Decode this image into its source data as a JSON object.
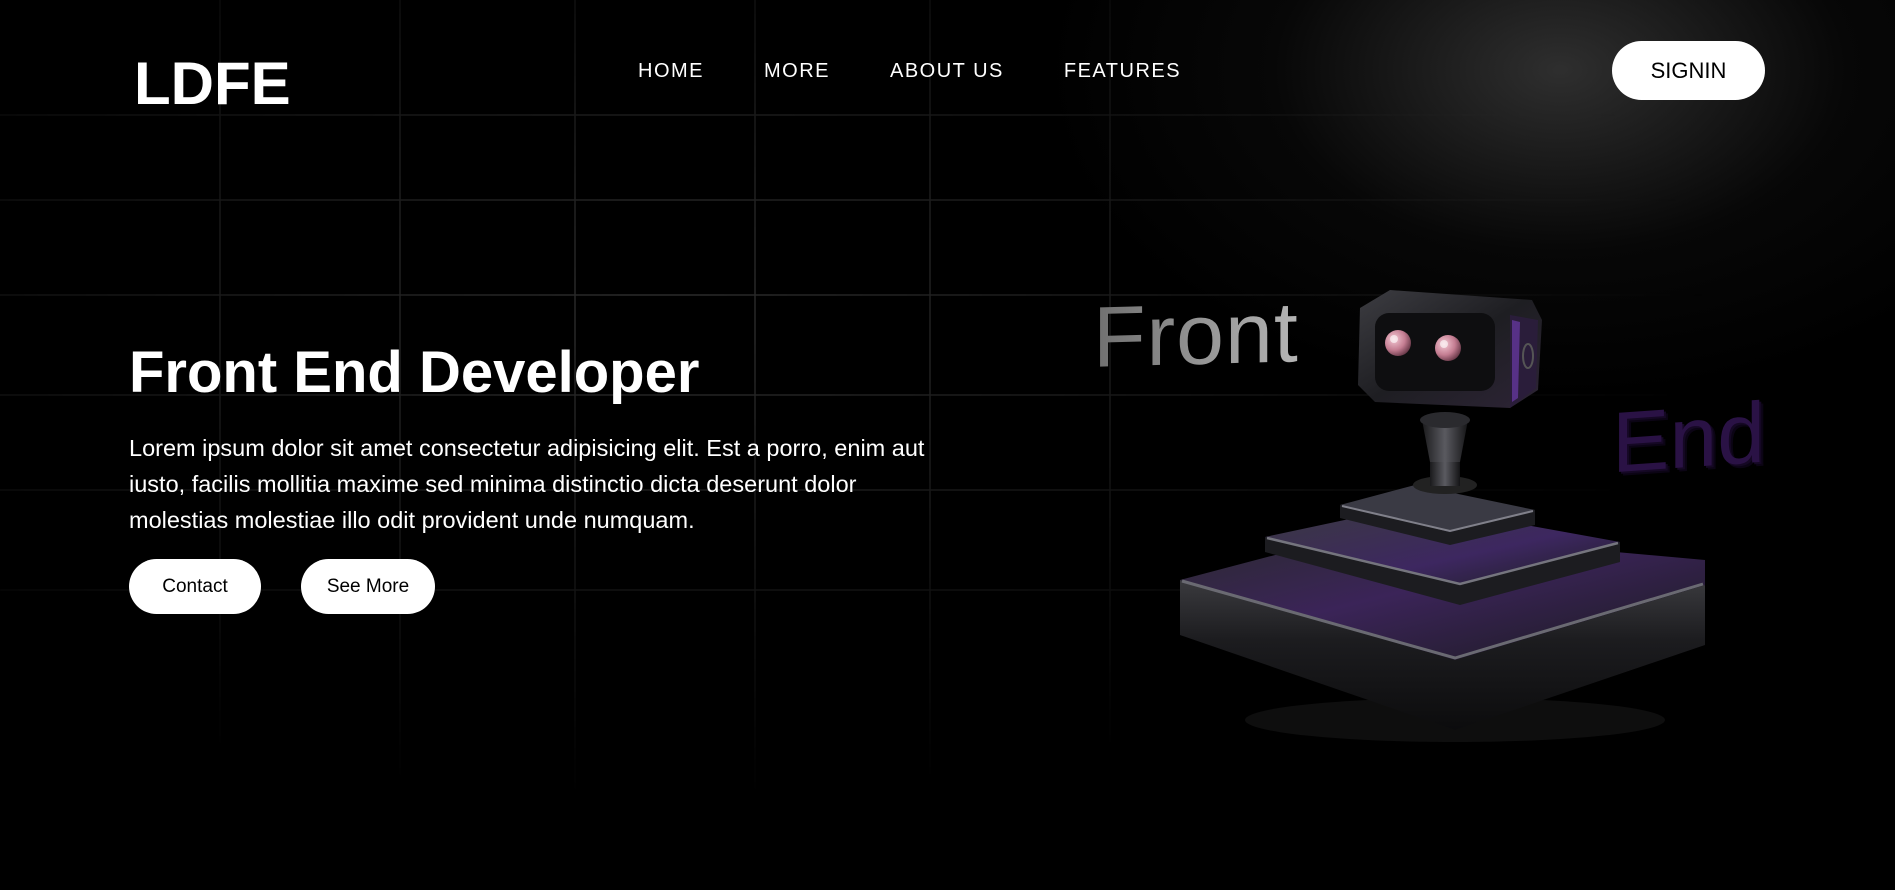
{
  "header": {
    "logo": "LDFE",
    "nav": [
      {
        "label": "HOME"
      },
      {
        "label": "MORE"
      },
      {
        "label": "ABOUT US"
      },
      {
        "label": "FEATURES"
      }
    ],
    "signin_label": "SIGNIN"
  },
  "hero": {
    "title": "Front End Developer",
    "description": "Lorem ipsum dolor sit amet consectetur adipisicing elit. Est a porro, enim aut iusto, facilis mollitia maxime sed minima distinctio dicta deserunt dolor molestias molestiae illo odit provident unde numquam.",
    "contact_label": "Contact",
    "see_more_label": "See More"
  },
  "illustration": {
    "word_1": "Front",
    "word_2": "End",
    "icon": "robot-joystick-icon"
  },
  "colors": {
    "background": "#000000",
    "text": "#ffffff",
    "button_bg": "#ffffff",
    "button_text": "#000000",
    "accent_purple": "#3a1a5e"
  }
}
